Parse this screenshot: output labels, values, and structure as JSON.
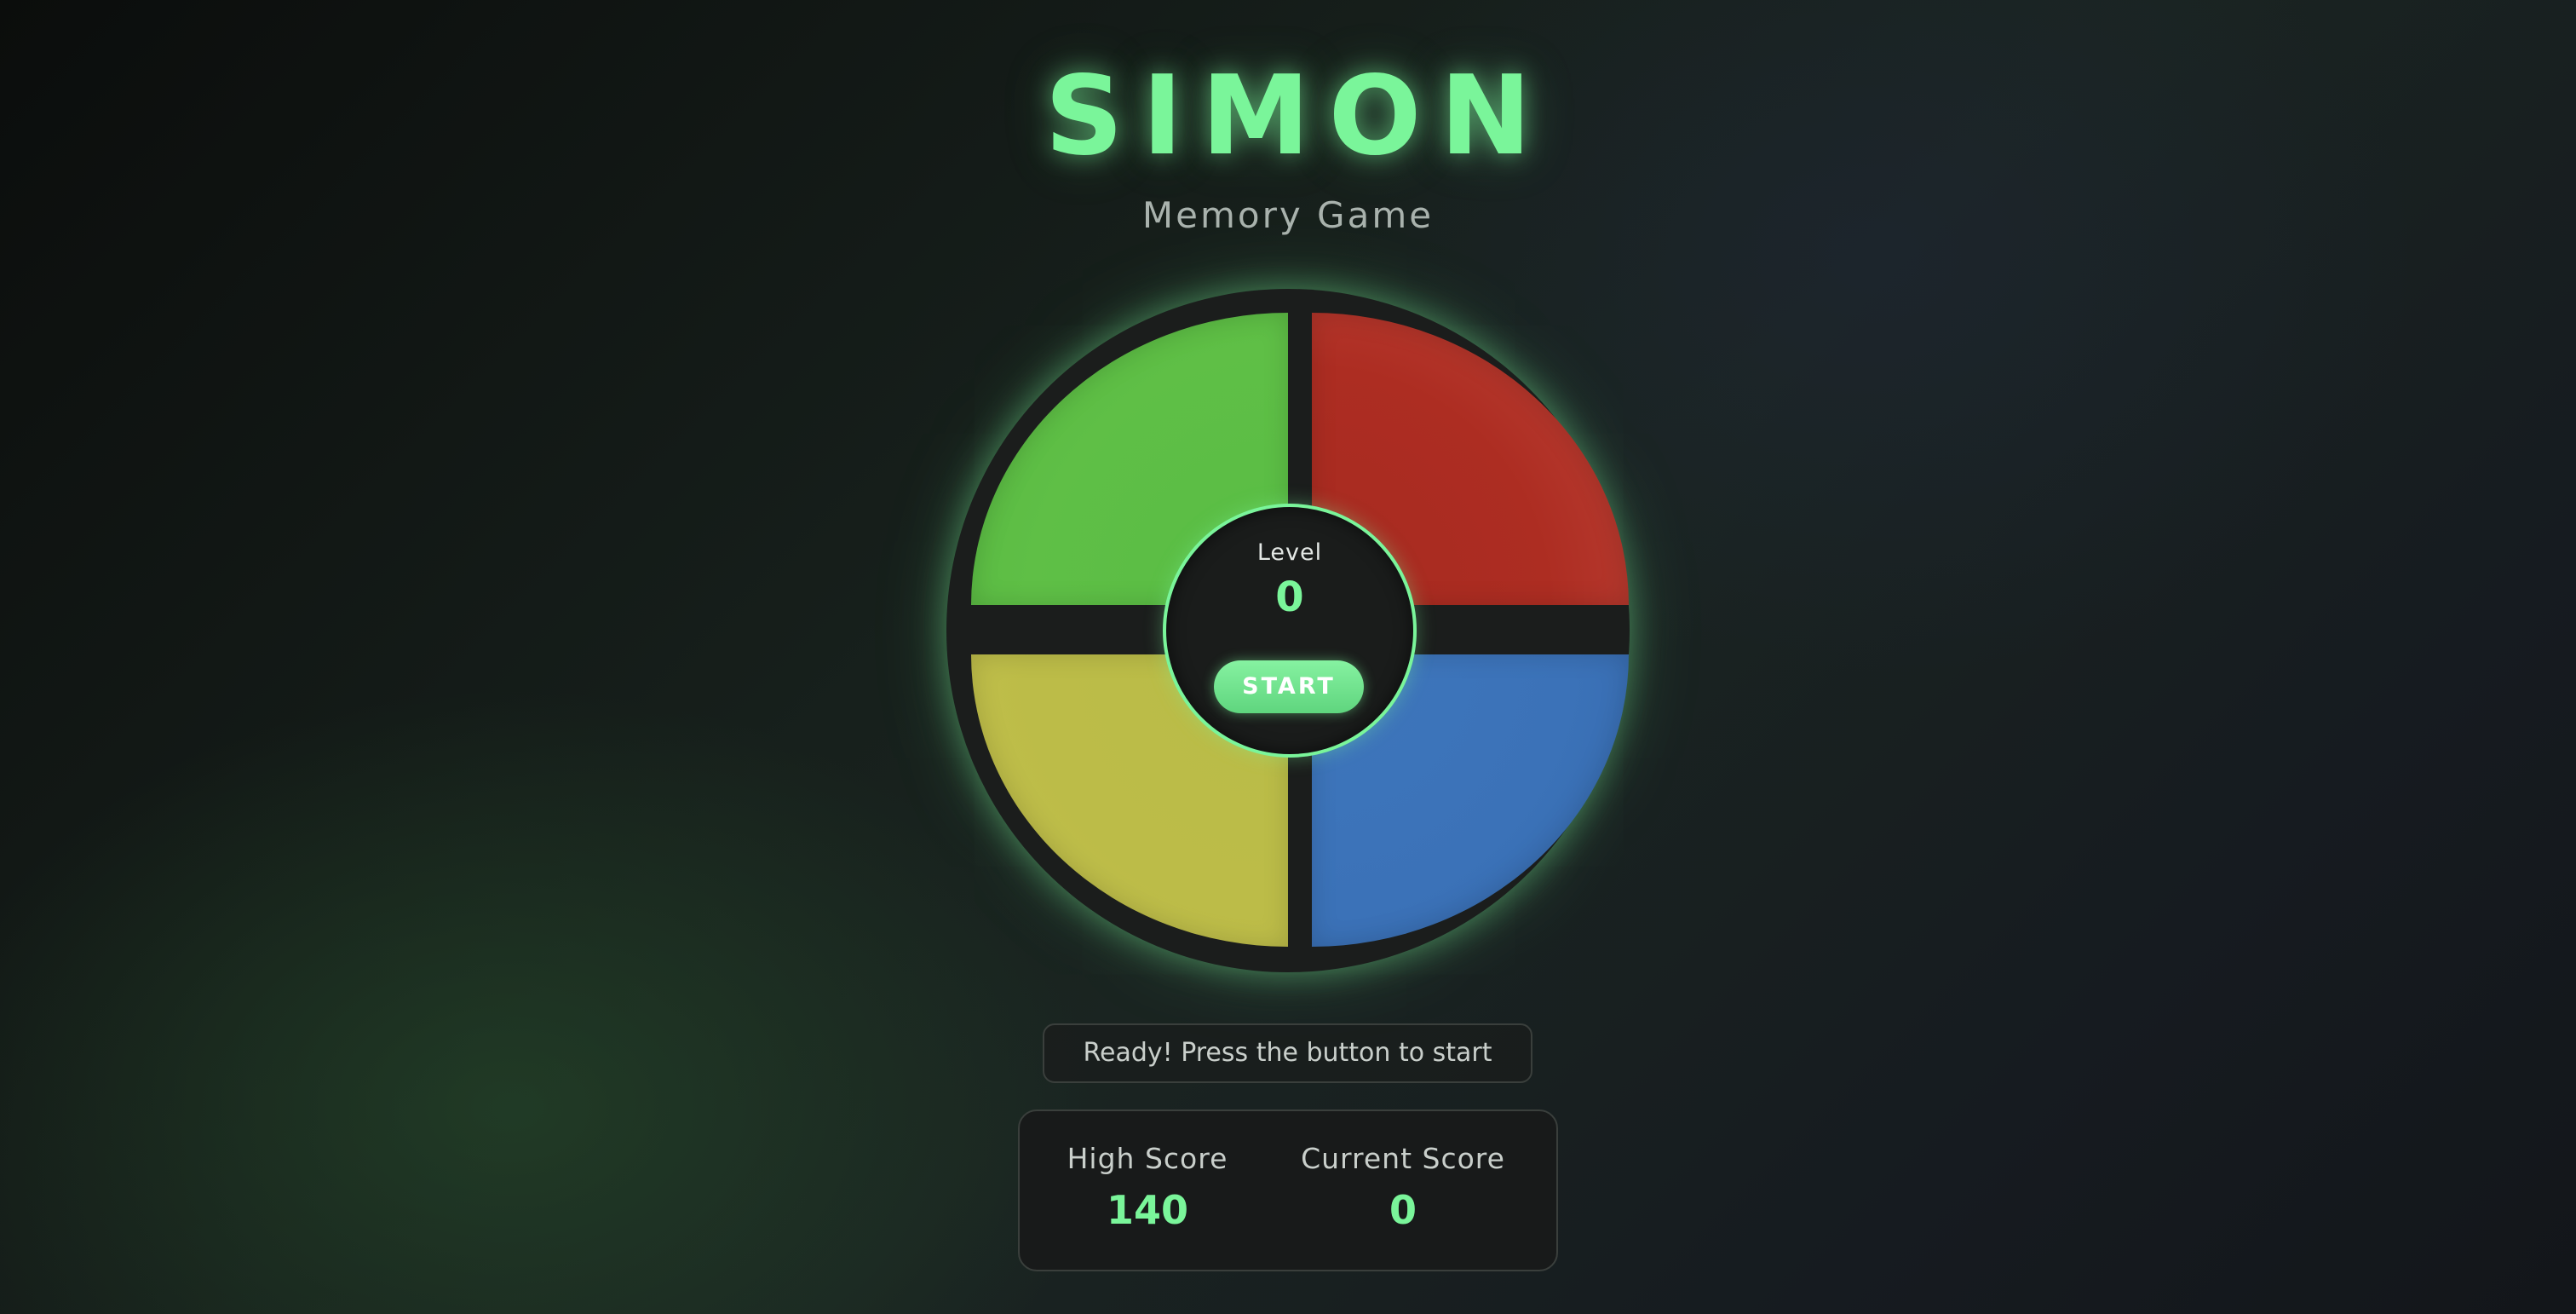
{
  "header": {
    "title": "SIMON",
    "subtitle": "Memory Game"
  },
  "board": {
    "pads": [
      {
        "id": "green",
        "color": "#5fbf46"
      },
      {
        "id": "red",
        "color": "#ad2d22"
      },
      {
        "id": "yellow",
        "color": "#bcbc48"
      },
      {
        "id": "blue",
        "color": "#3b72b8"
      }
    ],
    "center": {
      "level_label": "Level",
      "level_value": "0",
      "start_label": "START"
    }
  },
  "status": {
    "message": "Ready! Press the button to start"
  },
  "scores": {
    "high_label": "High Score",
    "high_value": "140",
    "current_label": "Current Score",
    "current_value": "0"
  },
  "theme": {
    "accent": "#7af59a"
  }
}
